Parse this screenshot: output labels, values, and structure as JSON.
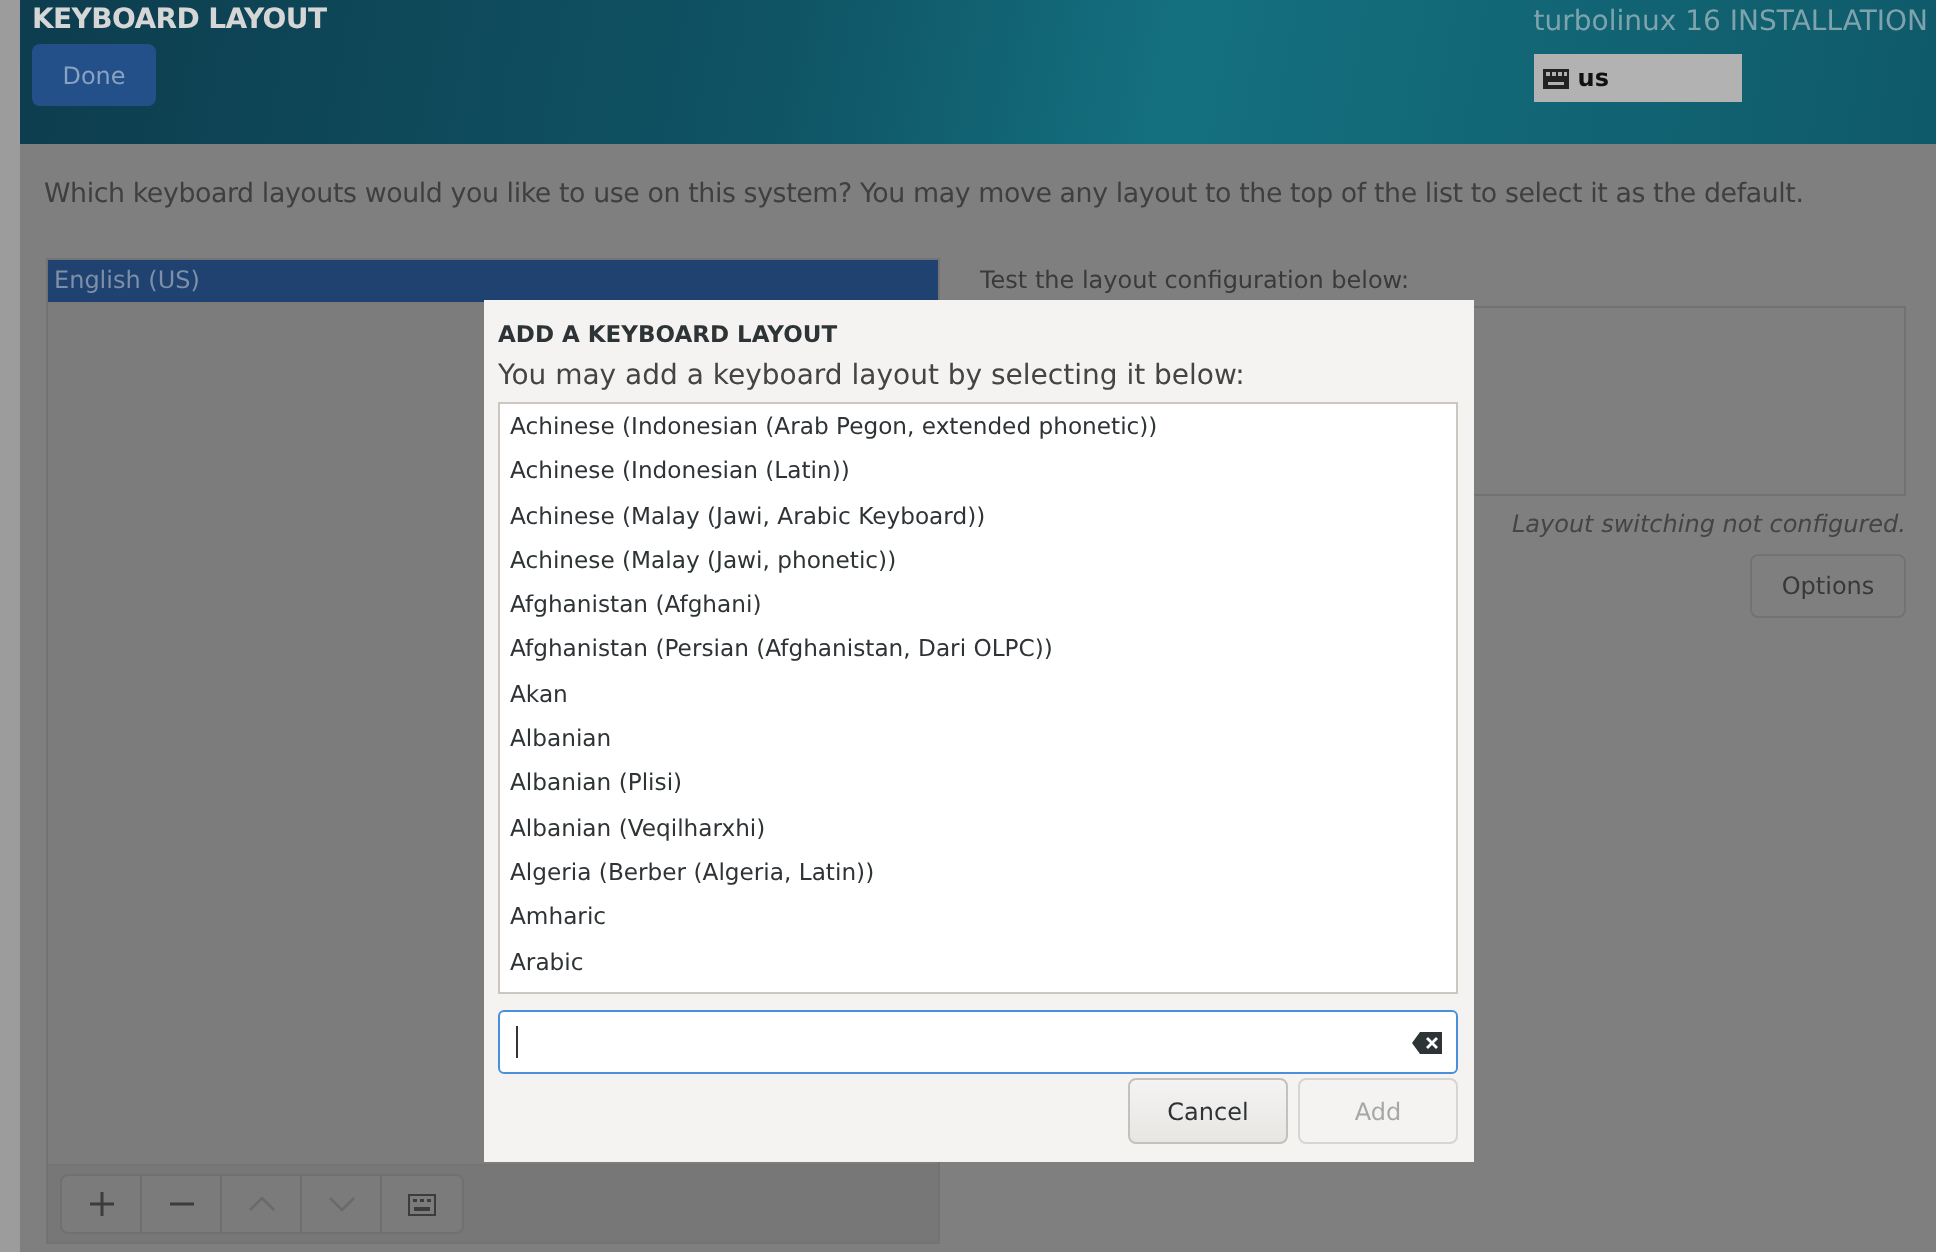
{
  "header": {
    "title": "KEYBOARD LAYOUT",
    "done_button": "Done",
    "product": "turbolinux 16 INSTALLATION",
    "keyboard_indicator": "us"
  },
  "prompt": "Which keyboard layouts would you like to use on this system?  You may move any layout to the top of the list to select it as the default.",
  "layouts": [
    {
      "label": "English (US)",
      "selected": true
    }
  ],
  "toolbar": [
    {
      "kind": "add",
      "disabled": false
    },
    {
      "kind": "remove",
      "disabled": false
    },
    {
      "kind": "up",
      "disabled": true
    },
    {
      "kind": "down",
      "disabled": true
    },
    {
      "kind": "preview",
      "disabled": false
    }
  ],
  "test": {
    "label": "Test the layout configuration below:",
    "switching_note": "Layout switching not configured.",
    "options_button": "Options"
  },
  "dialog": {
    "title": "ADD A KEYBOARD LAYOUT",
    "subtitle": "You may add a keyboard layout by selecting it below:",
    "items": [
      {
        "label": "Achinese (Indonesian (Arab Pegon, extended phonetic))",
        "selected": false
      },
      {
        "label": "Achinese (Indonesian (Latin))",
        "selected": false
      },
      {
        "label": "Achinese (Malay (Jawi, Arabic Keyboard))",
        "selected": false
      },
      {
        "label": "Achinese (Malay (Jawi, phonetic))",
        "selected": false
      },
      {
        "label": "Afghanistan (Afghani)",
        "selected": false
      },
      {
        "label": "Afghanistan (Persian (Afghanistan, Dari OLPC))",
        "selected": false
      },
      {
        "label": "Akan",
        "selected": false
      },
      {
        "label": "Albanian",
        "selected": false
      },
      {
        "label": "Albanian (Plisi)",
        "selected": false
      },
      {
        "label": "Albanian (Veqilharxhi)",
        "selected": false
      },
      {
        "label": "Algeria (Berber (Algeria, Latin))",
        "selected": false
      },
      {
        "label": "Amharic",
        "selected": false
      },
      {
        "label": "Arabic",
        "selected": false
      }
    ],
    "buttons": [
      {
        "label": "Cancel",
        "disabled": false
      },
      {
        "label": "Add",
        "disabled": true
      }
    ]
  }
}
